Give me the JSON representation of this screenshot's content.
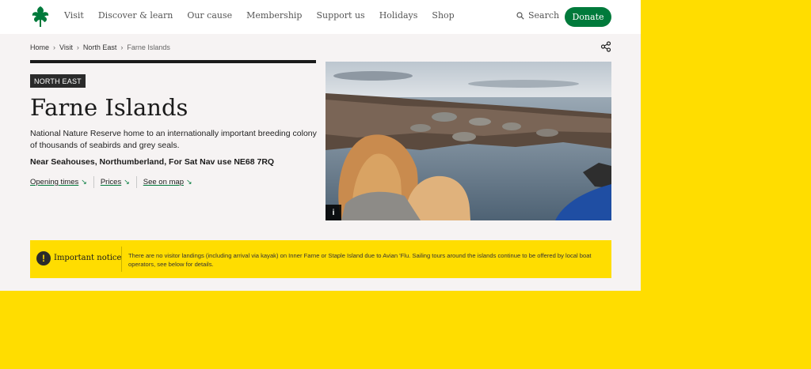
{
  "header": {
    "nav": [
      "Visit",
      "Discover & learn",
      "Our cause",
      "Membership",
      "Support us",
      "Holidays",
      "Shop"
    ],
    "search_label": "Search",
    "donate_label": "Donate"
  },
  "breadcrumb": [
    "Home",
    "Visit",
    "North East",
    "Farne Islands"
  ],
  "place": {
    "region_tag": "NORTH EAST",
    "title": "Farne Islands",
    "description": "National Nature Reserve home to an internationally important breeding colony of thousands of seabirds and grey seals.",
    "address": "Near Seahouses, Northumberland, For Sat Nav use NE68 7RQ",
    "links": [
      "Opening times",
      "Prices",
      "See on map"
    ]
  },
  "photo": {
    "info_label": "i"
  },
  "notice": {
    "title": "Important notice",
    "text": "There are no visitor landings (including arrival via kayak) on Inner Farne or Staple Island due to Avian 'Flu. Sailing tours around the islands continue to be offered by local boat operators, see below for details."
  },
  "icons": {
    "logo": "oak-leaf-logo",
    "search": "search-icon",
    "share": "share-icon",
    "notice": "exclamation-icon"
  },
  "colors": {
    "brand_green": "#007a3b",
    "notice_yellow": "#ffdd00",
    "page_bg": "#f6f3f3"
  }
}
